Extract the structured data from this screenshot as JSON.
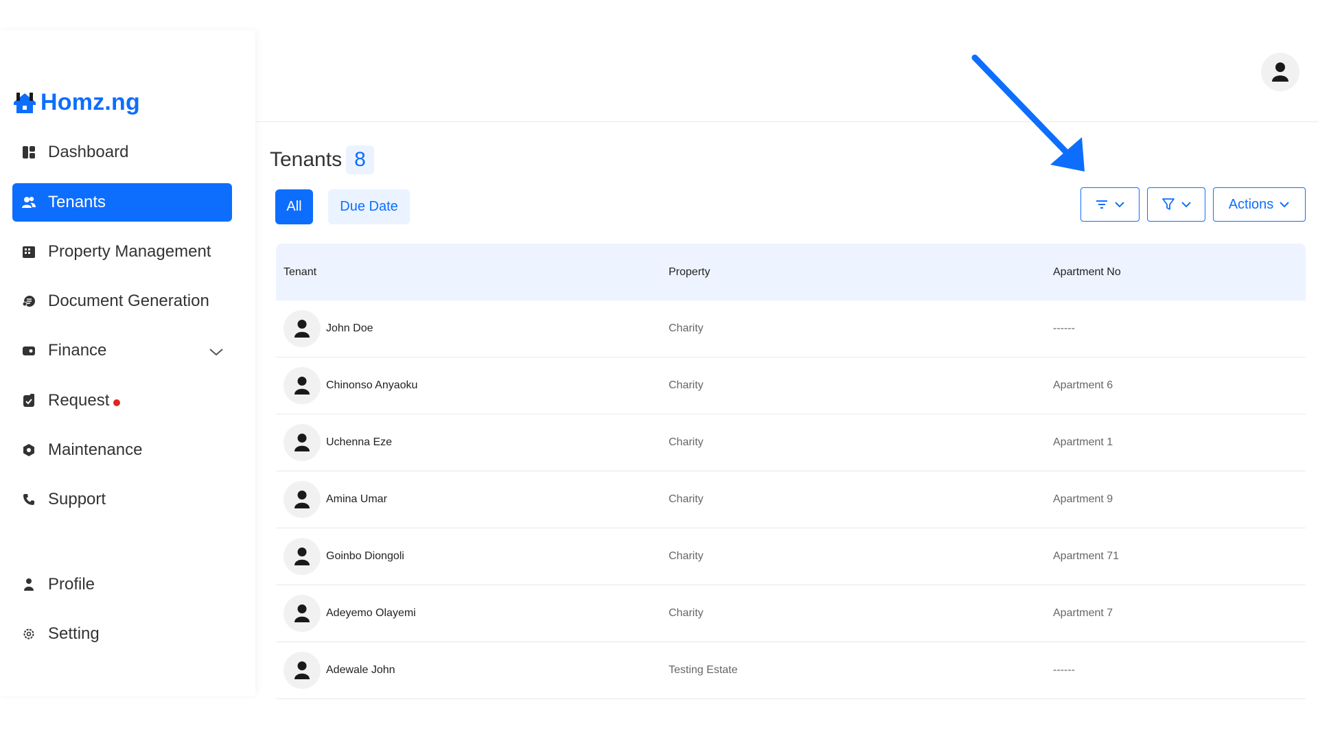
{
  "brand": {
    "name": "Homz.ng",
    "accent": "#0d6efd"
  },
  "sidebar": {
    "items": [
      {
        "label": "Dashboard",
        "icon": "dashboard-icon"
      },
      {
        "label": "Tenants",
        "icon": "users-icon",
        "active": true
      },
      {
        "label": "Property Management",
        "icon": "building-icon"
      },
      {
        "label": "Document Generation",
        "icon": "document-icon"
      },
      {
        "label": "Finance",
        "icon": "wallet-icon"
      },
      {
        "label": "Request",
        "icon": "request-icon",
        "has_notification": true
      },
      {
        "label": "Maintenance",
        "icon": "maintenance-icon"
      },
      {
        "label": "Support",
        "icon": "phone-icon"
      },
      {
        "label": "Profile",
        "icon": "person-icon"
      },
      {
        "label": "Setting",
        "icon": "gear-icon"
      }
    ]
  },
  "page": {
    "title": "Tenants",
    "count": "8",
    "tabs": [
      {
        "label": "All",
        "active": true
      },
      {
        "label": "Due Date"
      }
    ],
    "toolbar": {
      "actions_label": "Actions"
    }
  },
  "table": {
    "headers": [
      "Tenant",
      "Property",
      "Apartment No"
    ],
    "rows": [
      {
        "tenant": "John Doe",
        "property": "Charity",
        "apartment": "------"
      },
      {
        "tenant": "Chinonso Anyaoku",
        "property": "Charity",
        "apartment": "Apartment 6"
      },
      {
        "tenant": "Uchenna Eze",
        "property": "Charity",
        "apartment": "Apartment 1"
      },
      {
        "tenant": "Amina Umar",
        "property": "Charity",
        "apartment": "Apartment 9"
      },
      {
        "tenant": "Goinbo Diongoli",
        "property": "Charity",
        "apartment": "Apartment 71"
      },
      {
        "tenant": "Adeyemo Olayemi",
        "property": "Charity",
        "apartment": "Apartment 7"
      },
      {
        "tenant": "Adewale John",
        "property": "Testing Estate",
        "apartment": "------"
      }
    ]
  }
}
